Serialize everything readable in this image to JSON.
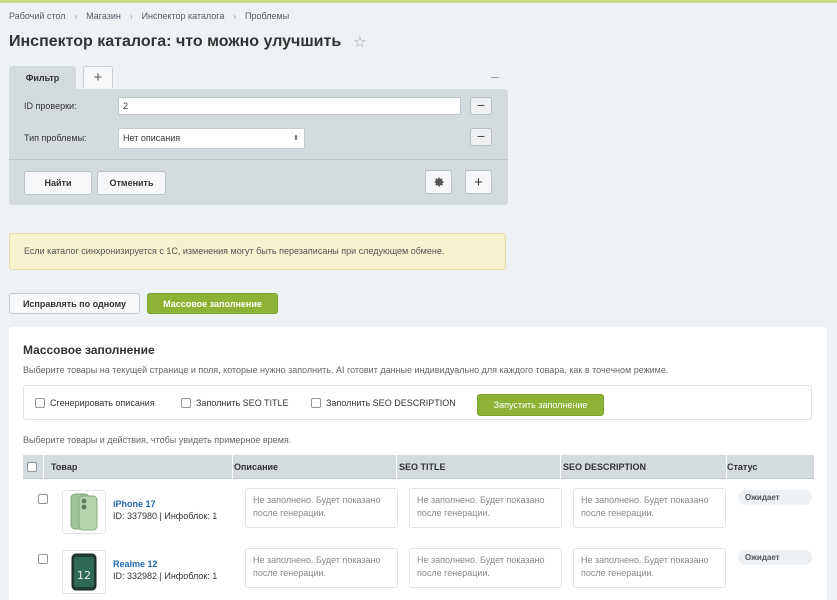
{
  "breadcrumb": [
    "Рабочий стол",
    "Магазин",
    "Инспектор каталога",
    "Проблемы"
  ],
  "page_title": "Инспектор каталога: что можно улучшить",
  "filter": {
    "tab_label": "Фильтр",
    "id_label": "ID проверки:",
    "id_value": "2",
    "type_label": "Тип проблемы:",
    "type_value": "Нет описания",
    "find_button": "Найти",
    "cancel_button": "Отменить"
  },
  "notice": "Если каталог синхронизируется с 1С, изменения могут быть перезаписаны при следующем обмене.",
  "modes": {
    "single": "Исправлять по одному",
    "mass": "Массовое заполнение"
  },
  "panel": {
    "title": "Массовое заполнение",
    "description": "Выберите товары на текущей странице и поля, которые нужно заполнить. AI готовит данные индивидуально для каждого товара, как в точечном режиме.",
    "options": {
      "gen_desc": "Сгенерировать описания",
      "seo_title": "Заполнить SEO TITLE",
      "seo_desc": "Заполнить SEO DESCRIPTION"
    },
    "run_button": "Запустить заполнение",
    "hint": "Выберите товары и действия, чтобы увидеть примерное время."
  },
  "table": {
    "columns": {
      "product": "Товар",
      "description": "Описание",
      "seo_title": "SEO TITLE",
      "seo_description": "SEO DESCRIPTION",
      "status": "Статус"
    },
    "placeholder_text": "Не заполнено. Будет показано после генерации.",
    "rows": [
      {
        "name": "iPhone 17",
        "meta": "ID: 337980 | Инфоблок: 1",
        "status": "Ожидает"
      },
      {
        "name": "Realme 12",
        "meta": "ID: 332982 | Инфоблок: 1",
        "status": "Ожидает"
      }
    ]
  },
  "colors": {
    "accent_green": "#8cb336",
    "link_blue": "#2067b0",
    "filter_bg": "#d4dbde"
  }
}
